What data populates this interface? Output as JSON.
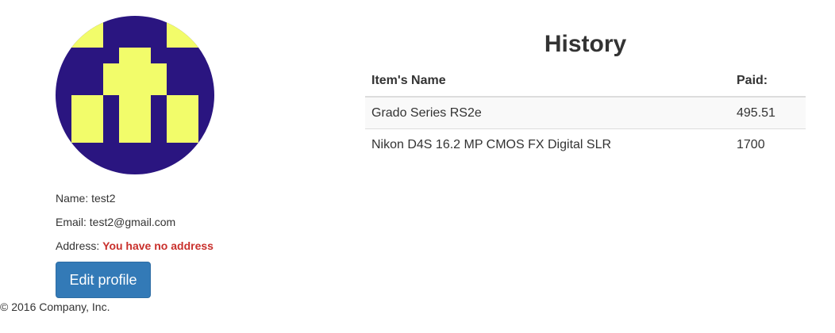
{
  "profile": {
    "avatar_icon": "identicon-avatar",
    "avatar_colors": {
      "background": "#2a1580",
      "foreground": "#f2fc6a"
    },
    "name_label": "Name:",
    "name_value": "test2",
    "email_label": "Email:",
    "email_value": "test2@gmail.com",
    "address_label": "Address:",
    "address_value": "You have no address",
    "address_color": "#c9302c",
    "edit_button_label": "Edit profile"
  },
  "history": {
    "title": "History",
    "columns": [
      "Item's Name",
      "Paid:"
    ],
    "rows": [
      {
        "item": "Grado Series RS2e",
        "paid": "495.51"
      },
      {
        "item": "Nikon D4S 16.2 MP CMOS FX Digital SLR",
        "paid": "1700"
      }
    ]
  },
  "footer": {
    "text": "© 2016 Company, Inc."
  },
  "colors": {
    "primary_button": "#337ab7",
    "text": "#333333",
    "error": "#c9302c"
  }
}
